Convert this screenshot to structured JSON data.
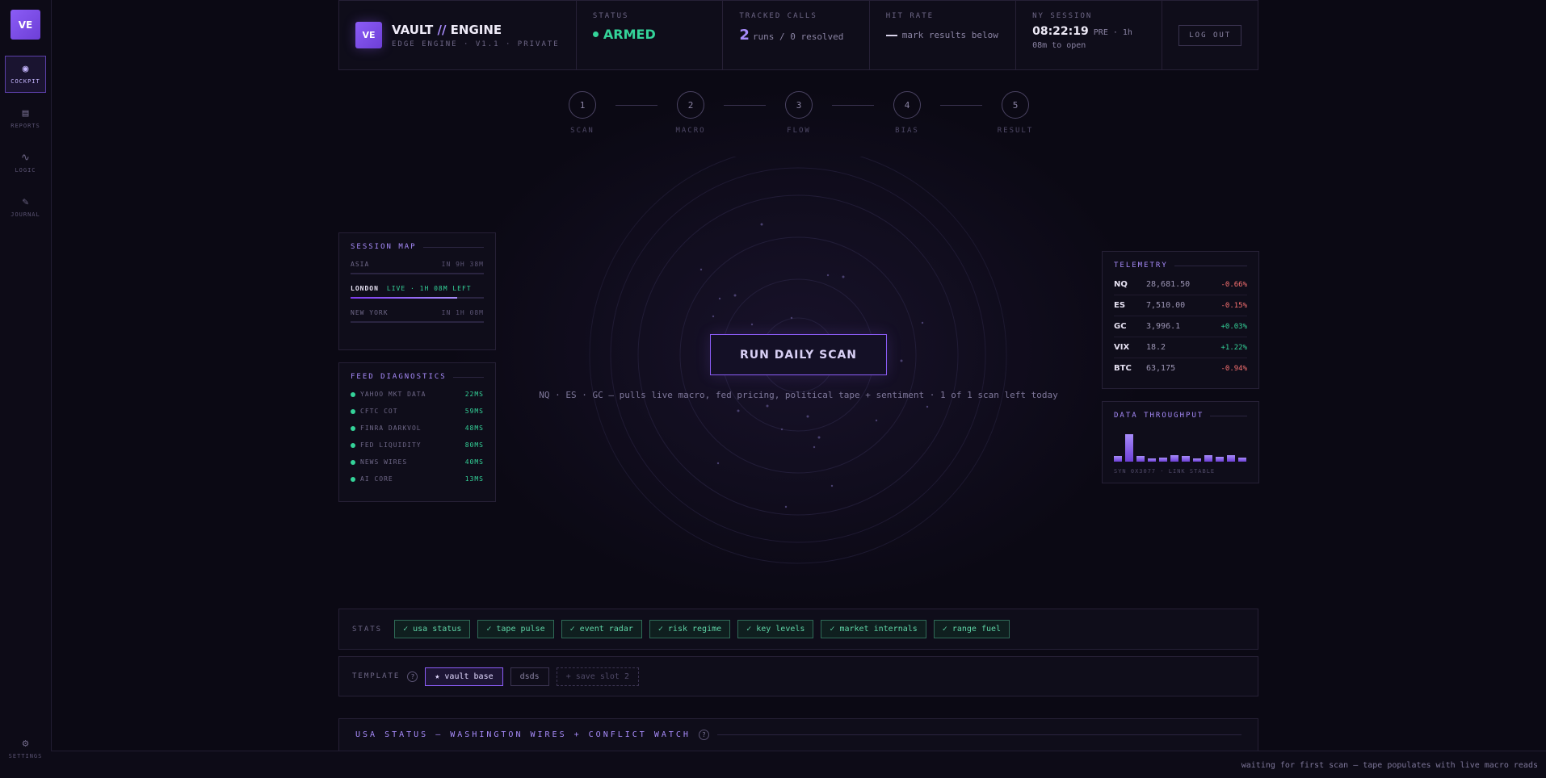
{
  "rail": {
    "logo": "VE",
    "items": [
      {
        "label": "COCKPIT",
        "icon": "◉"
      },
      {
        "label": "REPORTS",
        "icon": "▤"
      },
      {
        "label": "LOGIC",
        "icon": "∿"
      },
      {
        "label": "JOURNAL",
        "icon": "✎"
      }
    ],
    "settings": {
      "label": "SETTINGS",
      "icon": "⚙"
    }
  },
  "header": {
    "badge": "VE",
    "title_a": "VAULT",
    "title_sep": "//",
    "title_b": "ENGINE",
    "subtitle": "EDGE ENGINE · V1.1 · PRIVATE",
    "status_label": "STATUS",
    "status_value": "ARMED",
    "calls_label": "TRACKED CALLS",
    "calls_count": "2",
    "calls_detail": "runs / 0 resolved",
    "hit_label": "HIT RATE",
    "hit_detail": "mark results below",
    "session_label": "NY SESSION",
    "session_time": "08:22:19",
    "session_suffix": "PRE · 1h",
    "session_open": "08m to open",
    "logout": "LOG OUT"
  },
  "steps": [
    {
      "num": "1",
      "label": "SCAN"
    },
    {
      "num": "2",
      "label": "MACRO"
    },
    {
      "num": "3",
      "label": "FLOW"
    },
    {
      "num": "4",
      "label": "BIAS"
    },
    {
      "num": "5",
      "label": "RESULT"
    }
  ],
  "run": {
    "label": "RUN DAILY SCAN",
    "caption": "NQ · ES · GC — pulls live macro, fed pricing, political tape + sentiment · 1 of 1 scan left today"
  },
  "session_map": {
    "title": "SESSION MAP",
    "rows": [
      {
        "name": "ASIA",
        "status": "",
        "right": "IN 9H 38M",
        "progress": 0
      },
      {
        "name": "LONDON",
        "status": "LIVE · 1H 08M LEFT",
        "right": "",
        "progress": 0.8
      },
      {
        "name": "NEW YORK",
        "status": "",
        "right": "IN 1H 08M",
        "progress": 0
      }
    ]
  },
  "feeds": {
    "title": "FEED DIAGNOSTICS",
    "rows": [
      {
        "name": "YAHOO MKT DATA",
        "ms": "22MS"
      },
      {
        "name": "CFTC COT",
        "ms": "59MS"
      },
      {
        "name": "FINRA DARKVOL",
        "ms": "48MS"
      },
      {
        "name": "FED LIQUIDITY",
        "ms": "80MS"
      },
      {
        "name": "NEWS WIRES",
        "ms": "40MS"
      },
      {
        "name": "AI CORE",
        "ms": "13MS"
      }
    ]
  },
  "telemetry": {
    "title": "TELEMETRY",
    "rows": [
      {
        "sym": "NQ",
        "val": "28,681.50",
        "chg": "-0.66%",
        "dir": "neg"
      },
      {
        "sym": "ES",
        "val": "7,510.00",
        "chg": "-0.15%",
        "dir": "neg"
      },
      {
        "sym": "GC",
        "val": "3,996.1",
        "chg": "+0.03%",
        "dir": "pos"
      },
      {
        "sym": "VIX",
        "val": "18.2",
        "chg": "+1.22%",
        "dir": "pos"
      },
      {
        "sym": "BTC",
        "val": "63,175",
        "chg": "-0.94%",
        "dir": "neg"
      }
    ]
  },
  "throughput": {
    "title": "DATA THROUGHPUT",
    "levels": [
      0.22,
      1.0,
      0.22,
      0.12,
      0.15,
      0.24,
      0.22,
      0.12,
      0.25,
      0.18,
      0.25,
      0.14
    ],
    "footer": "SYN 0X3077 · LINK STABLE"
  },
  "stats": {
    "label": "STATS",
    "chips": [
      "✓ usa status",
      "✓ tape pulse",
      "✓ event radar",
      "✓ risk regime",
      "✓ key levels",
      "✓ market internals",
      "✓ range fuel"
    ]
  },
  "template": {
    "label": "TEMPLATE",
    "help": "?",
    "selected": "★ vault base",
    "other": "dsds",
    "slot": "+ save slot 2"
  },
  "usa": {
    "title": "USA STATUS — WASHINGTON WIRES + CONFLICT WATCH",
    "help": "?"
  },
  "footer": {
    "message": "waiting for first scan — tape populates with live macro reads"
  }
}
